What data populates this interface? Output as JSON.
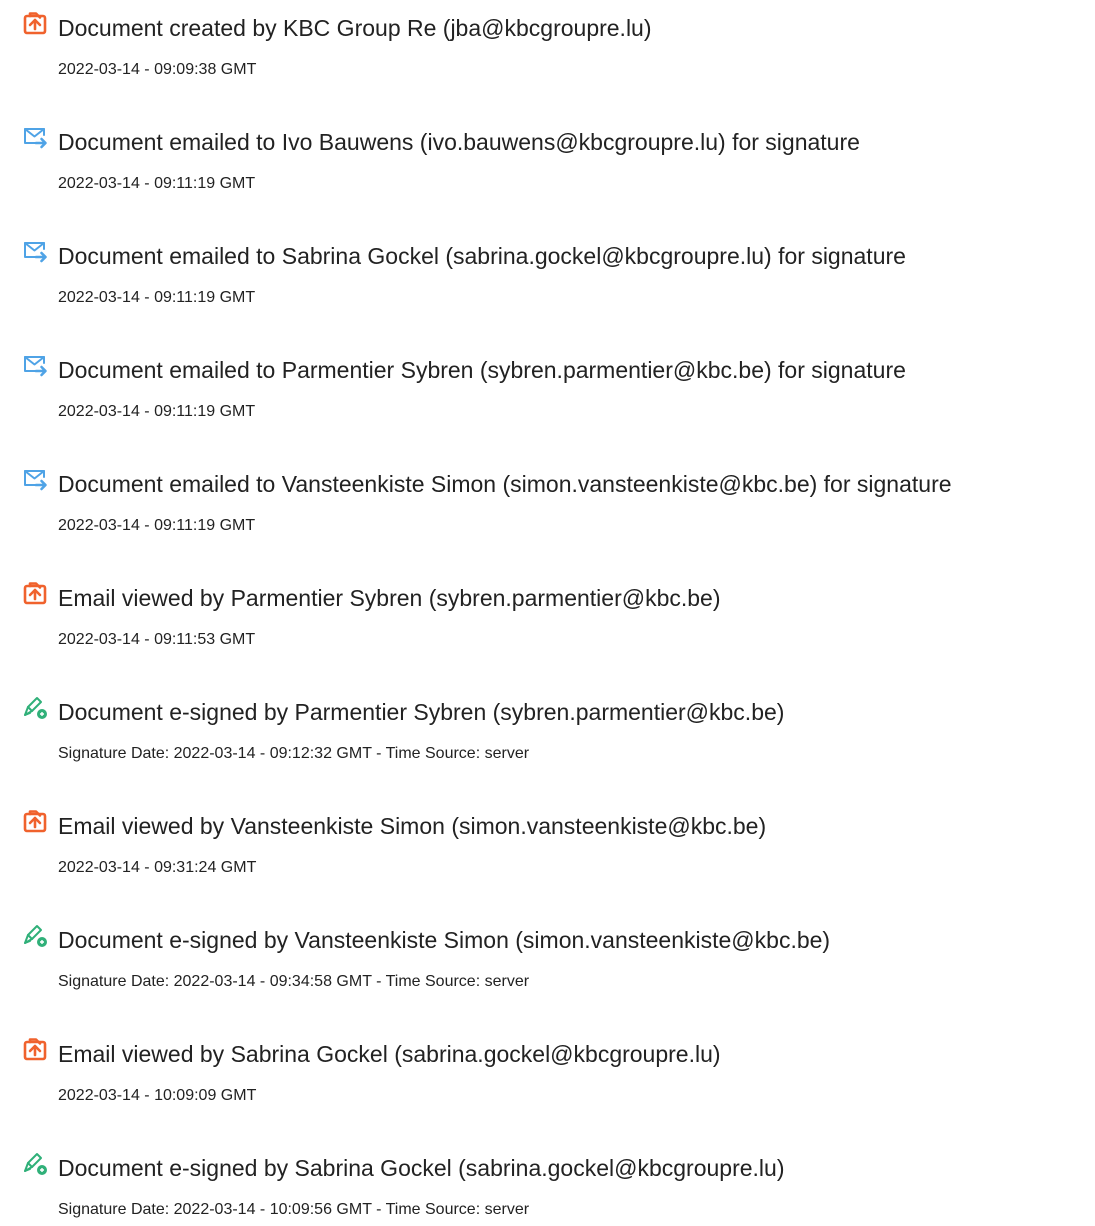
{
  "colors": {
    "created_icon": "#f0622d",
    "email_icon": "#4fa3e6",
    "signed_icon": "#30b079",
    "text": "#222222"
  },
  "events": [
    {
      "icon": "document-created-icon",
      "text": "Document created by KBC Group Re (jba@kbcgroupre.lu)",
      "detail": "2022-03-14 - 09:09:38 GMT"
    },
    {
      "icon": "email-sent-icon",
      "text": "Document emailed to Ivo Bauwens (ivo.bauwens@kbcgroupre.lu) for signature",
      "detail": "2022-03-14 - 09:11:19 GMT"
    },
    {
      "icon": "email-sent-icon",
      "text": "Document emailed to Sabrina Gockel (sabrina.gockel@kbcgroupre.lu) for signature",
      "detail": "2022-03-14 - 09:11:19 GMT"
    },
    {
      "icon": "email-sent-icon",
      "text": "Document emailed to Parmentier Sybren (sybren.parmentier@kbc.be) for signature",
      "detail": "2022-03-14 - 09:11:19 GMT"
    },
    {
      "icon": "email-sent-icon",
      "text": "Document emailed to Vansteenkiste Simon (simon.vansteenkiste@kbc.be) for signature",
      "detail": "2022-03-14 - 09:11:19 GMT"
    },
    {
      "icon": "email-viewed-icon",
      "text": "Email viewed by Parmentier Sybren (sybren.parmentier@kbc.be)",
      "detail": "2022-03-14 - 09:11:53 GMT"
    },
    {
      "icon": "e-signed-icon",
      "text": "Document e-signed by Parmentier Sybren (sybren.parmentier@kbc.be)",
      "detail": "Signature Date: 2022-03-14 - 09:12:32 GMT - Time Source: server"
    },
    {
      "icon": "email-viewed-icon",
      "text": "Email viewed by Vansteenkiste Simon (simon.vansteenkiste@kbc.be)",
      "detail": "2022-03-14 - 09:31:24 GMT"
    },
    {
      "icon": "e-signed-icon",
      "text": "Document e-signed by Vansteenkiste Simon (simon.vansteenkiste@kbc.be)",
      "detail": "Signature Date: 2022-03-14 - 09:34:58 GMT - Time Source: server"
    },
    {
      "icon": "email-viewed-icon",
      "text": "Email viewed by Sabrina Gockel (sabrina.gockel@kbcgroupre.lu)",
      "detail": "2022-03-14 - 10:09:09 GMT"
    },
    {
      "icon": "e-signed-icon",
      "text": "Document e-signed by Sabrina Gockel (sabrina.gockel@kbcgroupre.lu)",
      "detail": "Signature Date: 2022-03-14 - 10:09:56 GMT - Time Source: server"
    }
  ]
}
